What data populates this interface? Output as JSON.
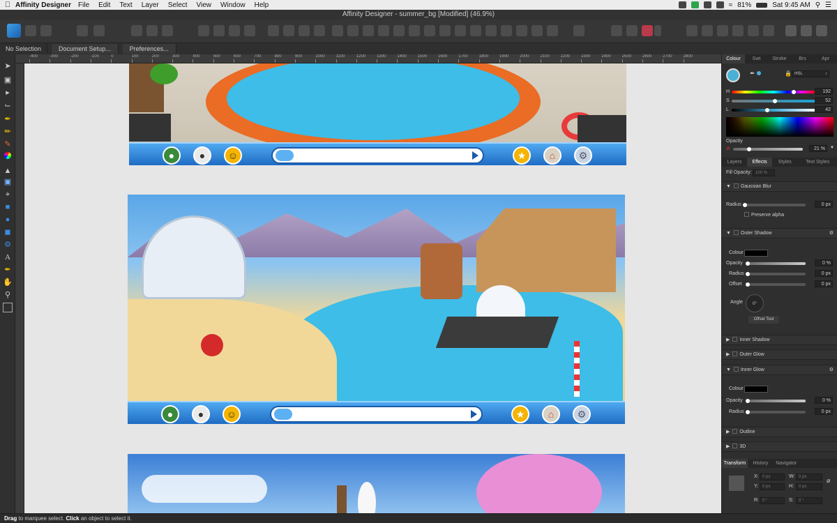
{
  "menubar": {
    "app_name": "Affinity Designer",
    "items": [
      "File",
      "Edit",
      "Text",
      "Layer",
      "Select",
      "View",
      "Window",
      "Help"
    ],
    "battery": "81%",
    "clock": "Sat 9:45 AM"
  },
  "window": {
    "title": "Affinity Designer - summer_bg [Modified] (46.9%)"
  },
  "context_bar": {
    "selection": "No Selection",
    "document_setup": "Document Setup...",
    "preferences": "Preferences..."
  },
  "ruler": {
    "ticks": [
      "-400",
      "-300",
      "-200",
      "-100",
      "0",
      "100",
      "200",
      "300",
      "400",
      "500",
      "600",
      "700",
      "800",
      "900",
      "1000",
      "1100",
      "1200",
      "1300",
      "1400",
      "1500",
      "1600",
      "1700",
      "1800",
      "1900",
      "2000",
      "2100",
      "2200",
      "2300",
      "2400",
      "2500",
      "2600",
      "2700",
      "2800"
    ]
  },
  "artboard_bar": {
    "icons": [
      "globe-icon",
      "penguin-icon",
      "smiley-icon",
      "chat-icon",
      "star-icon",
      "house-icon",
      "gear-icon"
    ]
  },
  "panel": {
    "tabs": [
      "Colour",
      "Swt",
      "Stroke",
      "Brs",
      "Apr"
    ],
    "colour_model": "HSL",
    "h_label": "H",
    "h_value": "192",
    "h_level": 0.75,
    "s_label": "S",
    "s_value": "52",
    "s_level": 0.52,
    "l_label": "L",
    "l_value": "42",
    "l_level": 0.42,
    "opacity_label": "Opacity",
    "opacity_value": "21 %",
    "opacity_level": 0.21,
    "sub_tabs": [
      "Layers",
      "Effects",
      "Styles",
      "Text Styles"
    ],
    "fill_opacity_label": "Fill Opacity:",
    "fill_opacity_value": "100 %",
    "gaussian_blur": "Gaussian Blur",
    "radius_label": "Radius",
    "zero_px": "0 px",
    "preserve_alpha": "Preserve alpha",
    "outer_shadow": "Outer Shadow",
    "colour_label": "Colour",
    "zero_pct": "0 %",
    "offset_label": "Offset",
    "angle_label": "Angle",
    "angle_value": "0°",
    "offset_tool": "Offset Tool",
    "inner_shadow": "Inner Shadow",
    "outer_glow": "Outer Glow",
    "inner_glow": "Inner Glow",
    "outline": "Outline",
    "three_d": "3D",
    "bottom_tabs": [
      "Transform",
      "History",
      "Navigator"
    ],
    "transform": {
      "x_label": "X:",
      "y_label": "Y:",
      "w_label": "W:",
      "h_label": "H:",
      "r_label": "R:",
      "s_label": "S:",
      "x": "0 px",
      "y": "0 px",
      "w": "0 px",
      "h": "0 px",
      "r": "0 °",
      "s": "0 °"
    }
  },
  "status": {
    "drag": "Drag",
    "text1": " to marquee select. ",
    "click": "Click",
    "text2": " an object to select it."
  },
  "colors": {
    "accent": "#3fa0e8",
    "sky": "#5aa6e8",
    "water": "#3dbde8",
    "sand": "#f2d898",
    "bar": "#1f6cc4"
  }
}
